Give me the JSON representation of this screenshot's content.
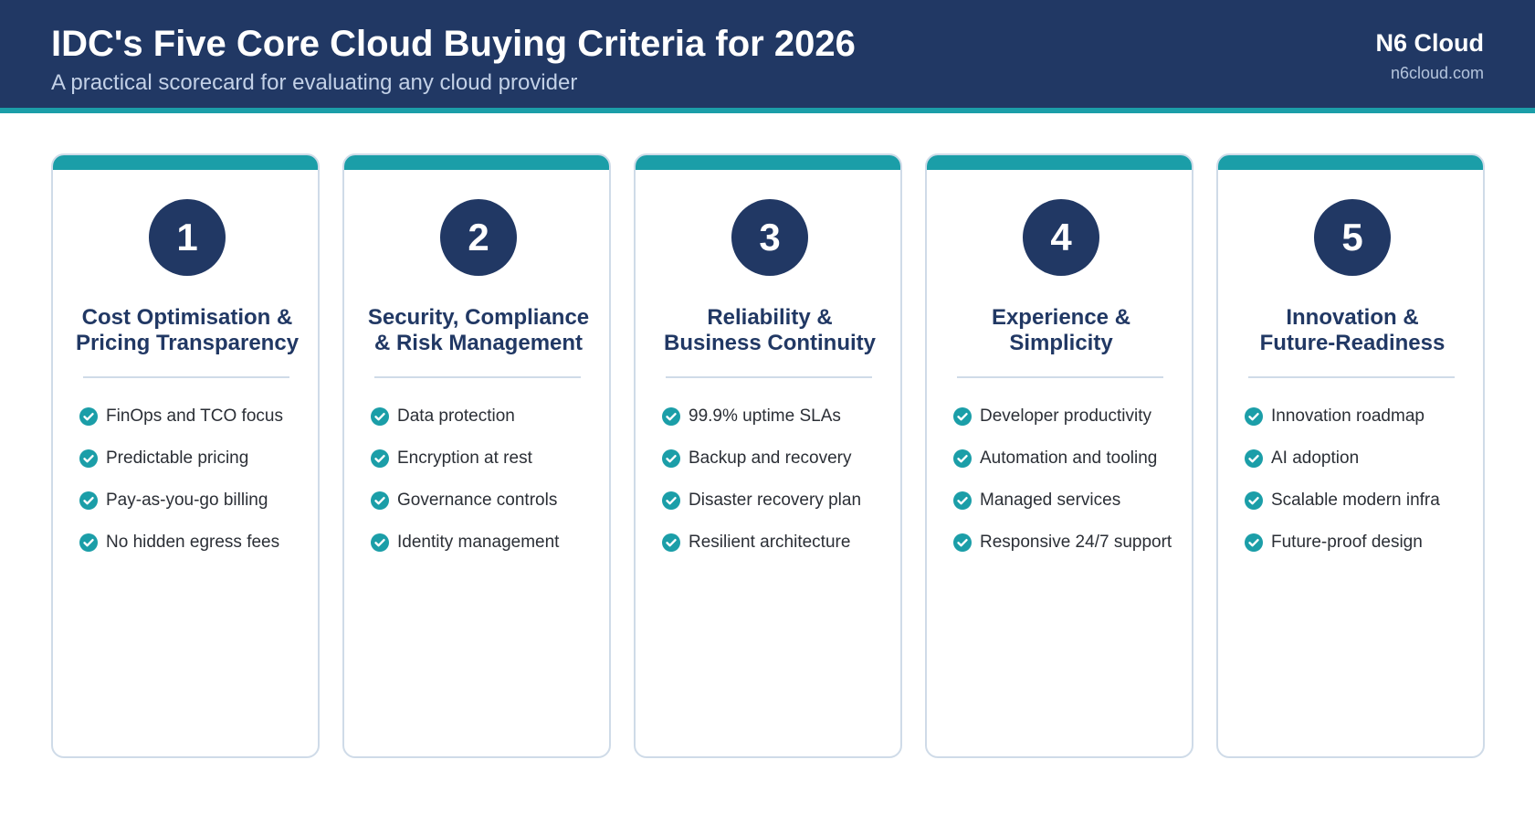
{
  "header": {
    "title": "IDC's Five Core Cloud Buying Criteria for 2026",
    "subtitle": "A practical scorecard for evaluating any cloud provider",
    "brand": "N6 Cloud",
    "brand_url": "n6cloud.com"
  },
  "colors": {
    "navy": "#213864",
    "teal": "#1b9ea8",
    "card_border": "#cfdbe8"
  },
  "cards": [
    {
      "number": "1",
      "title_lines": [
        "Cost Optimisation &",
        "Pricing Transparency"
      ],
      "items": [
        "FinOps and TCO focus",
        "Predictable pricing",
        "Pay-as-you-go billing",
        "No hidden egress fees"
      ]
    },
    {
      "number": "2",
      "title_lines": [
        "Security, Compliance",
        "& Risk Management"
      ],
      "items": [
        "Data protection",
        "Encryption at rest",
        "Governance controls",
        "Identity management"
      ]
    },
    {
      "number": "3",
      "title_lines": [
        "Reliability &",
        "Business Continuity"
      ],
      "items": [
        "99.9% uptime SLAs",
        "Backup and recovery",
        "Disaster recovery plan",
        "Resilient architecture"
      ]
    },
    {
      "number": "4",
      "title_lines": [
        "Experience &",
        "Simplicity"
      ],
      "items": [
        "Developer productivity",
        "Automation and tooling",
        "Managed services",
        "Responsive 24/7 support"
      ]
    },
    {
      "number": "5",
      "title_lines": [
        "Innovation &",
        "Future-Readiness"
      ],
      "items": [
        "Innovation roadmap",
        "AI adoption",
        "Scalable modern infra",
        "Future-proof design"
      ]
    }
  ]
}
